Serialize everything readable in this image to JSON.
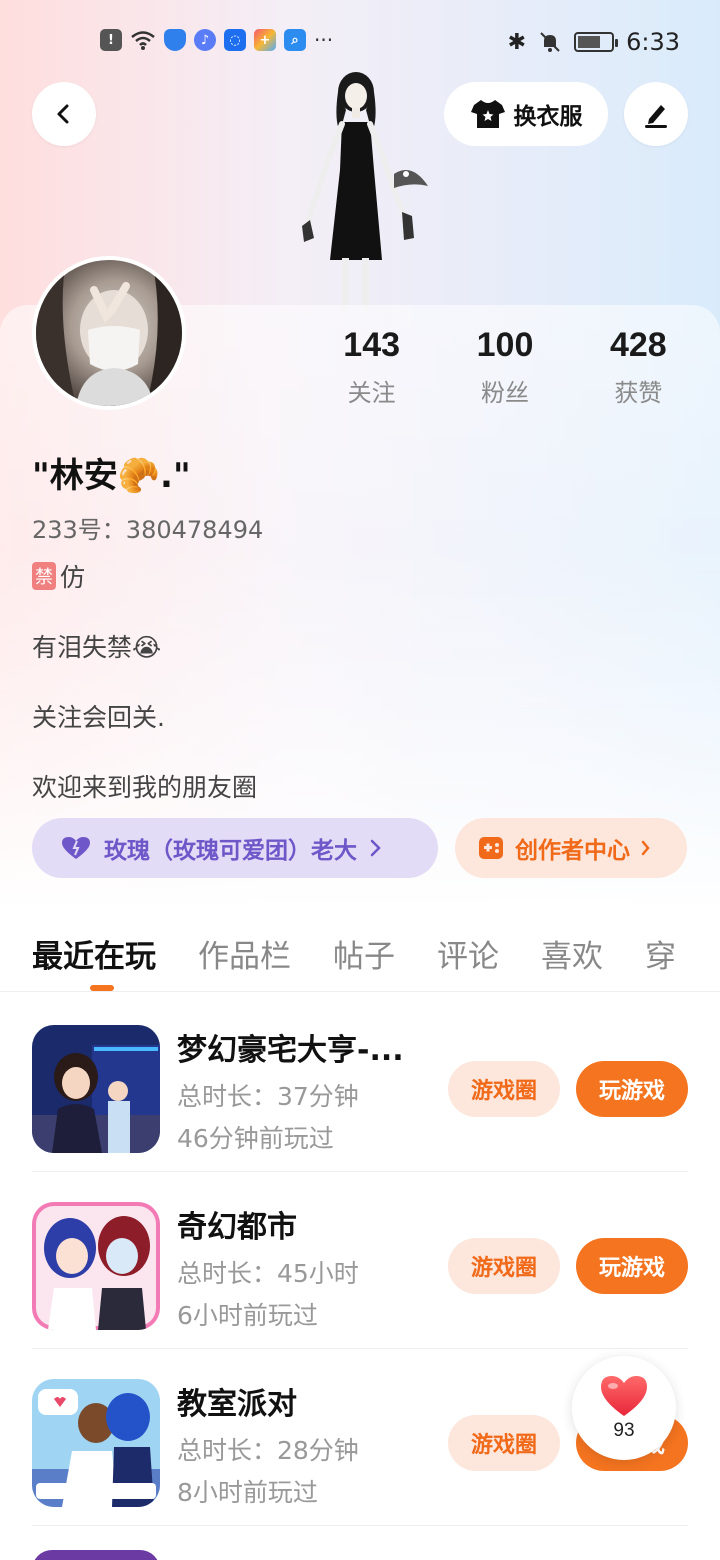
{
  "status_bar": {
    "time": "6:33",
    "more": "···"
  },
  "header": {
    "outfit_label": "换衣服"
  },
  "stats": [
    {
      "value": "143",
      "label": "关注"
    },
    {
      "value": "100",
      "label": "粉丝"
    },
    {
      "value": "428",
      "label": "获赞"
    }
  ],
  "profile": {
    "nickname": "\"林安🥐.\"",
    "uid": "233号：380478494",
    "tag_text": "禁",
    "tag_suffix": "仿",
    "bio": [
      "有泪失禁😭",
      "关注会回关.",
      "欢迎来到我的朋友圈"
    ]
  },
  "pills": {
    "group_label": "玫瑰（玫瑰可爱团）老大",
    "creator_label": "创作者中心"
  },
  "tabs": [
    "最近在玩",
    "作品栏",
    "帖子",
    "评论",
    "喜欢",
    "穿"
  ],
  "games": [
    {
      "title": "梦幻豪宅大亨-...",
      "duration": "总时长：37分钟",
      "last_played": "46分钟前玩过"
    },
    {
      "title": "奇幻都市",
      "duration": "总时长：45小时",
      "last_played": "6小时前玩过"
    },
    {
      "title": "教室派对",
      "duration": "总时长：28分钟",
      "last_played": "8小时前玩过"
    }
  ],
  "buttons": {
    "circle": "游戏圈",
    "play": "玩游戏"
  },
  "like": {
    "count": "93"
  },
  "colors": {
    "accent": "#f47420",
    "purple": "#6e57c9"
  }
}
